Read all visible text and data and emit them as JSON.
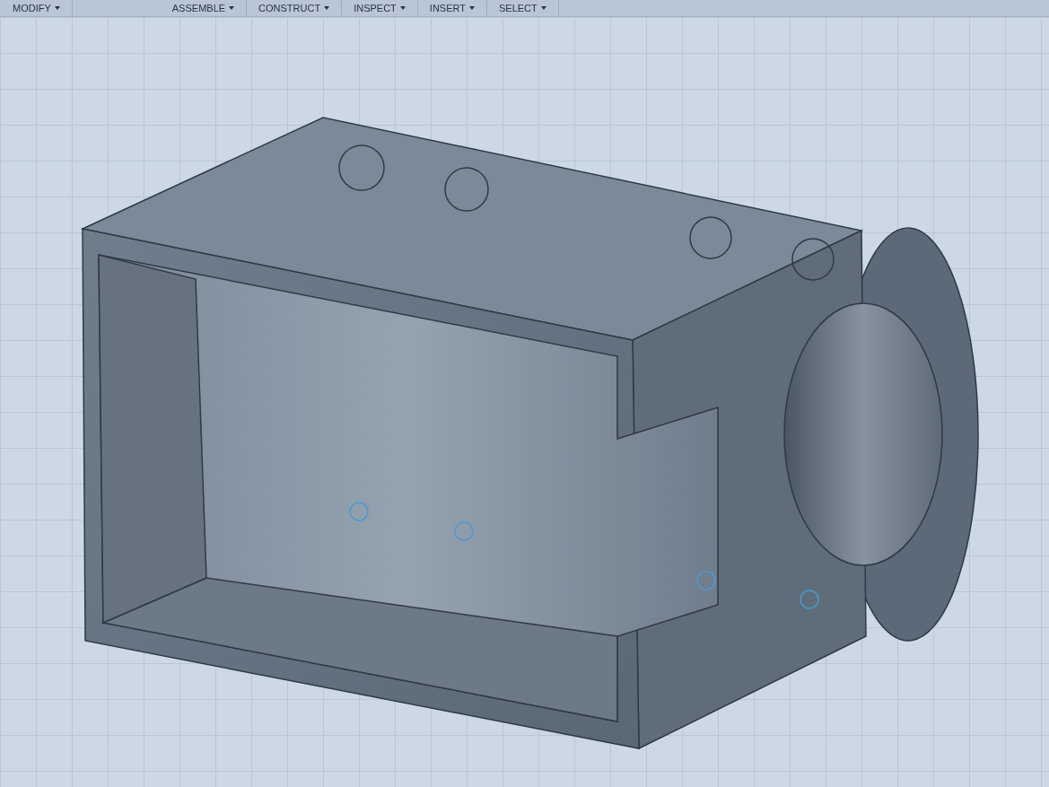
{
  "toolbar": {
    "menus": [
      {
        "label": "MODIFY"
      },
      {
        "label": "ASSEMBLE"
      },
      {
        "label": "CONSTRUCT"
      },
      {
        "label": "INSPECT"
      },
      {
        "label": "INSERT"
      },
      {
        "label": "SELECT"
      }
    ]
  }
}
